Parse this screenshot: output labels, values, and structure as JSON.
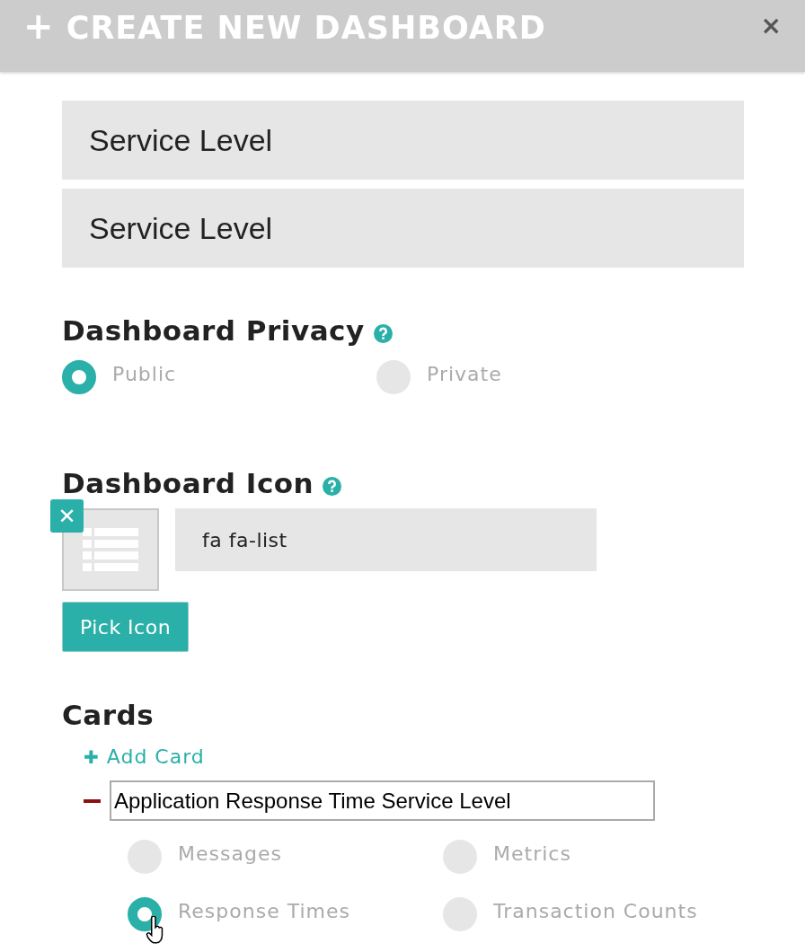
{
  "window": {
    "title": "CREATE NEW DASHBOARD",
    "title_icon": "+",
    "close": "×"
  },
  "fields": [
    {
      "value": "Service Level"
    },
    {
      "value": "Service Level"
    }
  ],
  "privacy": {
    "heading": "Dashboard Privacy",
    "options": [
      {
        "label": "Public",
        "selected": true
      },
      {
        "label": "Private",
        "selected": false
      }
    ]
  },
  "icon": {
    "heading": "Dashboard Icon",
    "remove": "✕",
    "value": "fa fa-list",
    "button": "Pick Icon"
  },
  "cards": {
    "heading": "Cards",
    "add_icon": "✚",
    "add": "Add Card",
    "items": [
      {
        "title": "Application Response Time Service Level",
        "options": [
          {
            "label": "Messages",
            "selected": false
          },
          {
            "label": "Metrics",
            "selected": false
          },
          {
            "label": "Response Times",
            "selected": true
          },
          {
            "label": "Transaction Counts",
            "selected": false
          }
        ]
      }
    ]
  }
}
